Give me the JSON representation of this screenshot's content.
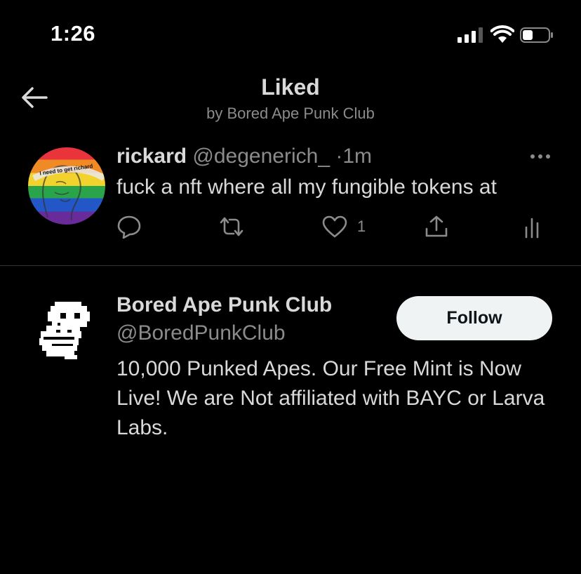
{
  "status_bar": {
    "time": "1:26"
  },
  "header": {
    "title": "Liked",
    "subtitle": "by Bored Ape Punk Club"
  },
  "tweet": {
    "author_name": "rickard",
    "author_handle": "@degenerich_",
    "separator": "·",
    "time": "1m",
    "text": "fuck a nft where all my fungible tokens at",
    "like_count": "1",
    "avatar_caption": "I need to get richard"
  },
  "account": {
    "name": "Bored Ape Punk Club",
    "handle": "@BoredPunkClub",
    "follow_label": "Follow",
    "bio": "10,000 Punked Apes. Our Free Mint is Now Live! We are Not affiliated with BAYC or Larva Labs."
  },
  "colors": {
    "background": "#000000",
    "text": "#d9d9d9",
    "secondary": "#8b8b8b",
    "divider": "#333333",
    "follow_bg": "#eff3f4"
  }
}
